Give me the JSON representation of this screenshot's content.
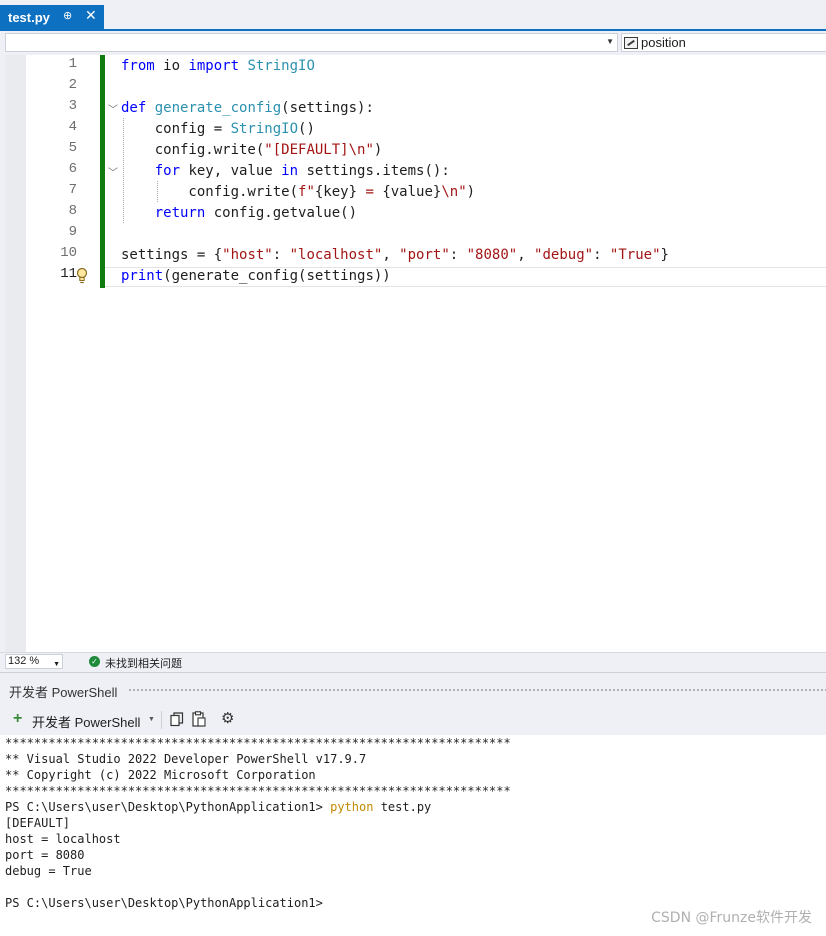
{
  "tab": {
    "title": "test.py",
    "pin_glyph": "⊕",
    "close_glyph": "✕"
  },
  "navbar": {
    "member_label": "position",
    "member_icon": "field-icon"
  },
  "editor": {
    "line_numbers": [
      "1",
      "2",
      "3",
      "4",
      "5",
      "6",
      "7",
      "8",
      "9",
      "10",
      "11"
    ],
    "current_line": "11",
    "lines": [
      [
        {
          "t": "from",
          "c": "kw"
        },
        {
          "t": " io "
        },
        {
          "t": "import",
          "c": "kw"
        },
        {
          "t": " "
        },
        {
          "t": "StringIO",
          "c": "ty"
        }
      ],
      [],
      [
        {
          "t": "def",
          "c": "kw"
        },
        {
          "t": " "
        },
        {
          "t": "generate_config",
          "c": "ty"
        },
        {
          "t": "(settings):"
        }
      ],
      [
        {
          "t": "    config = "
        },
        {
          "t": "StringIO",
          "c": "ty"
        },
        {
          "t": "()"
        }
      ],
      [
        {
          "t": "    config.write("
        },
        {
          "t": "\"[DEFAULT]\\n\"",
          "c": "st"
        },
        {
          "t": ")"
        }
      ],
      [
        {
          "t": "    "
        },
        {
          "t": "for",
          "c": "kw"
        },
        {
          "t": " key, value "
        },
        {
          "t": "in",
          "c": "kw"
        },
        {
          "t": " settings.items():"
        }
      ],
      [
        {
          "t": "        config.write("
        },
        {
          "t": "f\"",
          "c": "st"
        },
        {
          "t": "{key}"
        },
        {
          "t": " = ",
          "c": "st"
        },
        {
          "t": "{value}"
        },
        {
          "t": "\\n\"",
          "c": "st"
        },
        {
          "t": ")"
        }
      ],
      [
        {
          "t": "    "
        },
        {
          "t": "return",
          "c": "kw"
        },
        {
          "t": " config.getvalue()"
        }
      ],
      [],
      [
        {
          "t": "settings = {"
        },
        {
          "t": "\"host\"",
          "c": "st"
        },
        {
          "t": ": "
        },
        {
          "t": "\"localhost\"",
          "c": "st"
        },
        {
          "t": ", "
        },
        {
          "t": "\"port\"",
          "c": "st"
        },
        {
          "t": ": "
        },
        {
          "t": "\"8080\"",
          "c": "st"
        },
        {
          "t": ", "
        },
        {
          "t": "\"debug\"",
          "c": "st"
        },
        {
          "t": ": "
        },
        {
          "t": "\"True\"",
          "c": "st"
        },
        {
          "t": "}"
        }
      ],
      [
        {
          "t": "print",
          "c": "kw"
        },
        {
          "t": "(generate_config(settings))"
        }
      ]
    ]
  },
  "status": {
    "zoom": "132 %",
    "issues": "未找到相关问题"
  },
  "panel": {
    "title": "开发者 PowerShell",
    "toolbar_label": "开发者 PowerShell"
  },
  "terminal": {
    "lines": [
      [
        {
          "t": "**********************************************************************"
        }
      ],
      [
        {
          "t": "** Visual Studio 2022 Developer PowerShell v17.9.7"
        }
      ],
      [
        {
          "t": "** Copyright (c) 2022 Microsoft Corporation"
        }
      ],
      [
        {
          "t": "**********************************************************************"
        }
      ],
      [
        {
          "t": "PS C:\\Users\\user\\Desktop\\PythonApplication1> "
        },
        {
          "t": "python",
          "c": "cmd"
        },
        {
          "t": " test.py"
        }
      ],
      [
        {
          "t": "[DEFAULT]"
        }
      ],
      [
        {
          "t": "host = localhost"
        }
      ],
      [
        {
          "t": "port = 8080"
        }
      ],
      [
        {
          "t": "debug = True"
        }
      ],
      [],
      [
        {
          "t": "PS C:\\Users\\user\\Desktop\\PythonApplication1>"
        }
      ]
    ]
  },
  "watermark": "CSDN @Frunze软件开发",
  "colors": {
    "accent": "#0e70c0",
    "keyword": "#0000ff",
    "type": "#2b91af",
    "string": "#a31515",
    "change_bar": "#107c10"
  }
}
